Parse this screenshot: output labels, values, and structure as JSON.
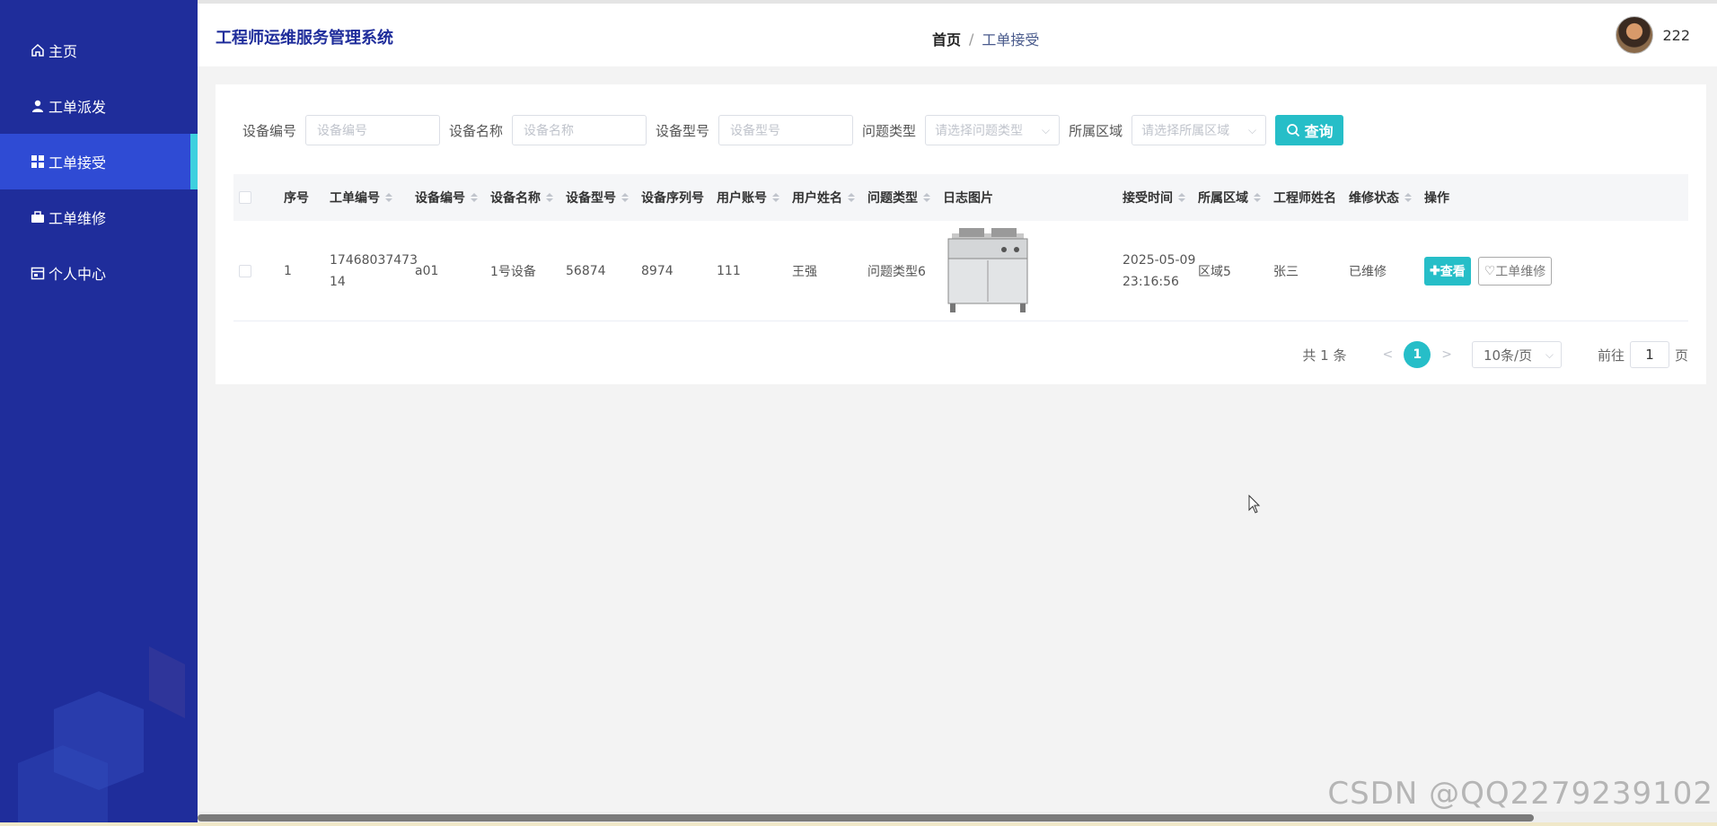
{
  "sidebar": {
    "items": [
      {
        "label": "主页",
        "icon": "home-icon"
      },
      {
        "label": "工单派发",
        "icon": "user-icon"
      },
      {
        "label": "工单接受",
        "icon": "grid-icon",
        "active": true
      },
      {
        "label": "工单维修",
        "icon": "briefcase-icon"
      },
      {
        "label": "个人中心",
        "icon": "calendar-icon"
      }
    ]
  },
  "header": {
    "title": "工程师运维服务管理系统",
    "breadcrumb_home": "首页",
    "breadcrumb_sep": "/",
    "breadcrumb_current": "工单接受",
    "username": "222"
  },
  "search": {
    "fields": [
      {
        "label": "设备编号",
        "placeholder": "设备编号",
        "type": "input"
      },
      {
        "label": "设备名称",
        "placeholder": "设备名称",
        "type": "input"
      },
      {
        "label": "设备型号",
        "placeholder": "设备型号",
        "type": "input"
      },
      {
        "label": "问题类型",
        "placeholder": "请选择问题类型",
        "type": "select"
      },
      {
        "label": "所属区域",
        "placeholder": "请选择所属区域",
        "type": "select"
      }
    ],
    "query_label": "查询"
  },
  "table": {
    "headers": [
      "序号",
      "工单编号",
      "设备编号",
      "设备名称",
      "设备型号",
      "设备序列号",
      "用户账号",
      "用户姓名",
      "问题类型",
      "日志图片",
      "接受时间",
      "所属区域",
      "工程师姓名",
      "维修状态",
      "操作"
    ],
    "rows": [
      {
        "index": "1",
        "order_no_line1": "17468037473",
        "order_no_line2": "14",
        "device_no": "a01",
        "device_name": "1号设备",
        "device_model": "56874",
        "device_serial": "8974",
        "user_account": "111",
        "user_name": "王强",
        "problem_type": "问题类型6",
        "accept_date": "2025-05-09",
        "accept_time": "23:16:56",
        "region": "区域5",
        "engineer": "张三",
        "status": "已维修",
        "view_label": "查看",
        "repair_label": "工单维修"
      }
    ]
  },
  "pagination": {
    "total": "共 1 条",
    "current": "1",
    "page_size": "10条/页",
    "goto_label": "前往",
    "goto_value": "1",
    "page_unit": "页"
  },
  "watermark": "CSDN @QQ2279239102",
  "colors": {
    "sidebar": "#1f2d9b",
    "active": "#2f4bd4",
    "accent": "#26bec8"
  }
}
